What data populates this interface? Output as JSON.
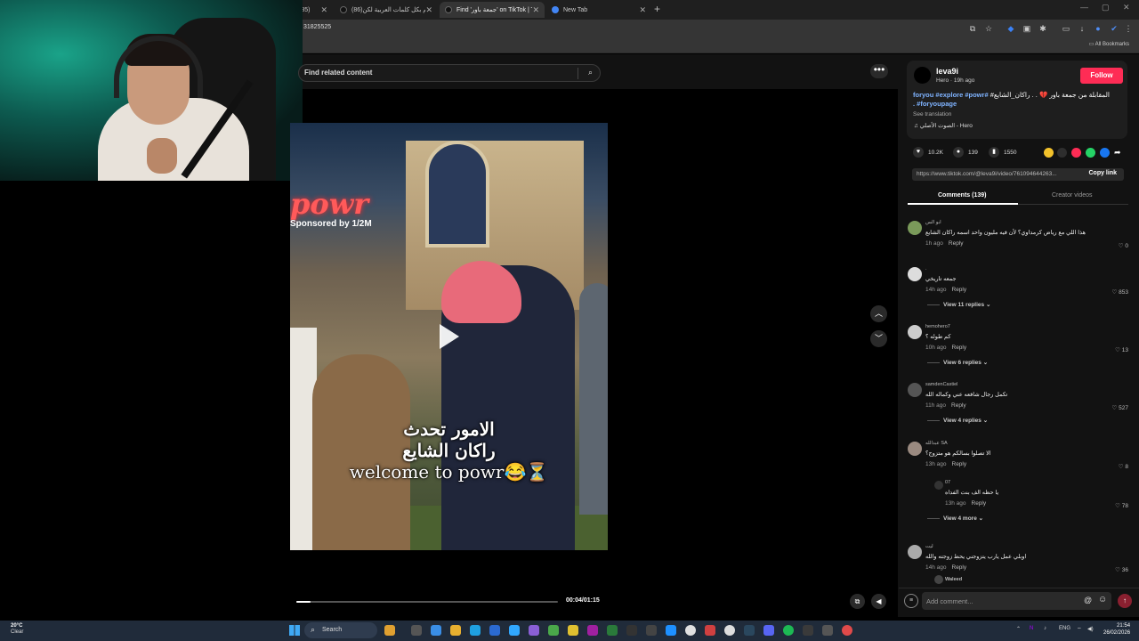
{
  "browser": {
    "tabs": [
      {
        "label": "(85)",
        "active": false
      },
      {
        "label": "(86)وتحم بكل كلمات العربية لكن",
        "active": false
      },
      {
        "label": "Find 'جمعة باور' on TikTok | Tik",
        "active": true
      },
      {
        "label": "New Tab",
        "active": false
      }
    ],
    "url": "31825525",
    "all_bookmarks": "All Bookmarks"
  },
  "search": {
    "placeholder": "Find related content"
  },
  "video": {
    "sign_text": "powr",
    "sponsor_text": "Sponsored by 1/2M",
    "caption_line1": "الامور تحدث",
    "caption_line2": "راكان الشايع",
    "caption_line3": "welcome to powr😂⏳",
    "progress": 0.054,
    "time": "00:04/01:15"
  },
  "post": {
    "author": "leva9i",
    "author_sub": "Hero · 19h ago",
    "follow_label": "Follow",
    "description_text": "المقابلة من جمعة باور 💔 . . راكان_الشايع#",
    "hashtags": "#foryou #explore #powr #foryoupage .",
    "see_translation": "See translation",
    "sound": "♫  الصوت الأصلي - Hero",
    "likes": "10.2K",
    "comments_count": "139",
    "saves": "1550",
    "link": "https://www.tiktok.com/@leva9i/video/761094644263...",
    "copy_link": "Copy link",
    "tab_comments": "Comments (139)",
    "tab_creator": "Creator videos"
  },
  "comments": [
    {
      "name": "ابو الس",
      "text": "هذا اللي مع رياض كرمداوي؟ لأن فيه مليون واحد اسمه راكان الشايع",
      "time": "1h ago",
      "reply": "Reply",
      "likes": "0",
      "replies": "",
      "avatar": "#7a9a5a"
    },
    {
      "name": ".",
      "text": "جمعه تاريخي",
      "time": "14h ago",
      "reply": "Reply",
      "likes": "853",
      "replies": "View 11 replies",
      "avatar": "#dddddd"
    },
    {
      "name": "hemohero7",
      "text": "كم طوله ؟",
      "time": "10h ago",
      "reply": "Reply",
      "likes": "13",
      "replies": "View 6 replies",
      "avatar": "#cccccc"
    },
    {
      "name": "samdenCastiel",
      "text": "تكمل رجال شافعه عني وكماله الله",
      "time": "11h ago",
      "reply": "Reply",
      "likes": "527",
      "replies": "View 4 replies",
      "avatar": "#555555"
    },
    {
      "name": "عبدالله SA",
      "text": "الا تصلوا بسالكم هو متزوج؟",
      "time": "13h ago",
      "reply": "Reply",
      "likes": "8",
      "replies": "",
      "avatar": "#9a8a80"
    },
    {
      "name": "07",
      "text": "يا حظه الف بنت الفداه",
      "time": "13h ago",
      "reply": "Reply",
      "likes": "78",
      "replies": "View 4 more",
      "avatar": "#333333",
      "is_reply": true
    },
    {
      "name": "ليت",
      "text": "اوبلي عمل يارب يتزوجني يحط زوجته والله",
      "time": "14h ago",
      "reply": "Reply",
      "likes": "36",
      "replies": "",
      "avatar": "#aaaaaa"
    },
    {
      "name": "Waleed",
      "text": "",
      "time": "",
      "reply": "",
      "likes": "",
      "replies": "",
      "avatar": "#444444",
      "is_reply": true
    }
  ],
  "add_comment": {
    "placeholder": "Add comment...",
    "at": "@",
    "emoji": "☺"
  },
  "taskbar": {
    "weather_temp": "20°C",
    "weather_desc": "Clear",
    "search_label": "Search",
    "lang": "ENG",
    "time": "21:54",
    "date": "26/02/2026"
  }
}
